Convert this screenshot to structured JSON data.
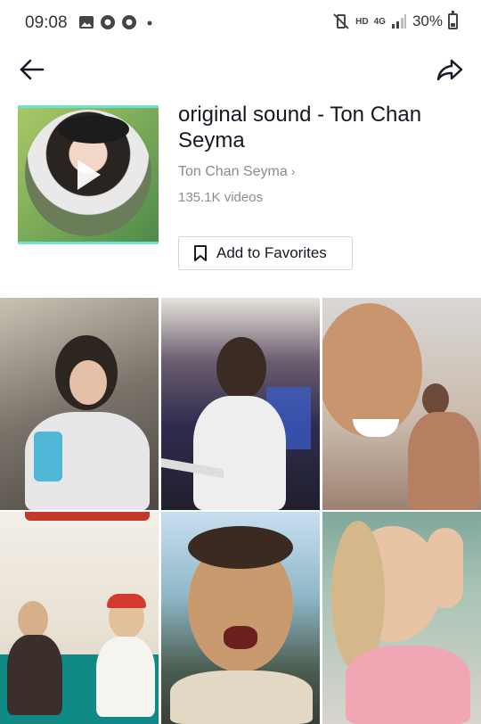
{
  "status_bar": {
    "time": "09:08",
    "network_hd": "HD",
    "network_type": "4G",
    "battery": "30%",
    "left_icons": [
      "image-icon",
      "chrome-icon",
      "chrome-icon",
      "dot-icon"
    ],
    "right_icons": [
      "mute-vibrate-icon",
      "signal-icon",
      "battery-icon"
    ]
  },
  "header": {
    "back_icon": "arrow-left-icon",
    "share_icon": "share-arrow-icon"
  },
  "sound": {
    "title": "original sound - Ton Chan Seyma",
    "author": "Ton Chan Seyma",
    "author_chevron": "›",
    "video_count": "135.1K videos",
    "favorite_label": "Add to Favorites",
    "cover_play_icon": "play-icon"
  },
  "videos": [
    {
      "id": 1,
      "colors": [
        "#6f6a63",
        "#c9c2b4"
      ]
    },
    {
      "id": 2,
      "colors": [
        "#3b3c61",
        "#e6e1da"
      ]
    },
    {
      "id": 3,
      "colors": [
        "#a48d74",
        "#d3b2a0"
      ]
    },
    {
      "id": 4,
      "colors": [
        "#f5f1ea",
        "#0f8a86"
      ]
    },
    {
      "id": 5,
      "colors": [
        "#566b6a",
        "#c7e0f0"
      ]
    },
    {
      "id": 6,
      "colors": [
        "#7fa79a",
        "#efe4de"
      ]
    }
  ]
}
